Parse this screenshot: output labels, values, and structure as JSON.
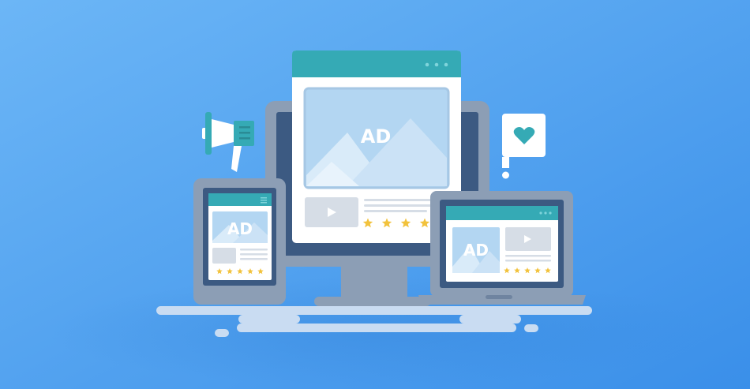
{
  "colors": {
    "background_light": "#6ab4f5",
    "background_dark": "#3a8fe8",
    "teal": "#35aab5",
    "frame_gray": "#8c9eb5",
    "screen_navy": "#3c5a82",
    "card_white": "#ffffff",
    "image_blue": "#b3d6f2",
    "star_yellow": "#f2c23c",
    "floor_line": "#c9dcf2"
  },
  "desktop_ad": {
    "ad_label": "AD",
    "icons": [
      "window-dots-icon",
      "image-mountain-icon",
      "play-icon",
      "star-icon"
    ],
    "rating_stars": 4
  },
  "tablet_ad": {
    "ad_label": "AD",
    "icons": [
      "hamburger-menu-icon",
      "image-mountain-icon",
      "star-icon"
    ],
    "rating_stars": 5
  },
  "laptop_ad": {
    "ad_label": "AD",
    "icons": [
      "window-dots-icon",
      "image-mountain-icon",
      "play-icon",
      "star-icon"
    ],
    "rating_stars": 5
  },
  "decorations": {
    "icons": [
      "megaphone-icon",
      "heart-speech-bubble-icon"
    ]
  }
}
